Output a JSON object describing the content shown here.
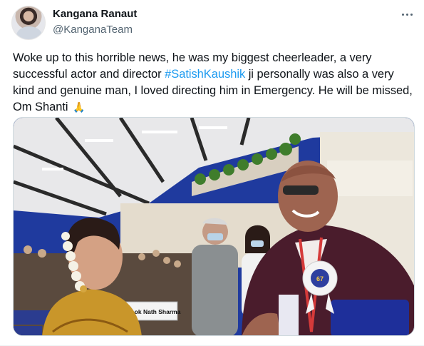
{
  "tweet": {
    "author": {
      "display_name": "Kangana Ranaut",
      "handle": "@KanganaTeam",
      "avatar_icon": "profile-photo"
    },
    "more_icon": "more-options-icon",
    "text_before": "Woke up to this horrible news, he was my biggest cheerleader, a very successful actor and director ",
    "hashtag": "#SatishKaushik",
    "text_after": " ji personally was also a very kind and genuine man, I loved directing him in Emergency. He will be missed, Om Shanti ",
    "emoji": "🙏",
    "media": {
      "name_plate": "Shri Lok Nath Sharma",
      "rosette_number": "67",
      "colors": {
        "accent_link": "#1d9bf0",
        "ceiling": "#e8e8ea",
        "wall_blue": "#1f3a9e",
        "jacket": "#4a1c2c",
        "saree_gold": "#c9962a"
      }
    }
  }
}
